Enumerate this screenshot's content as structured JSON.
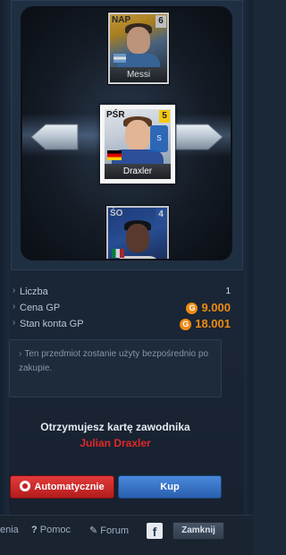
{
  "carousel": {
    "cards": [
      {
        "position": "NAP",
        "number": "6",
        "name": "Messi"
      },
      {
        "position": "PŚR",
        "number": "5",
        "name": "Draxler"
      },
      {
        "position": "ŚO",
        "number": "4",
        "name": ""
      }
    ]
  },
  "info": {
    "count_label": "Liczba",
    "count_value": "1",
    "price_label": "Cena GP",
    "price_value": "9.000",
    "balance_label": "Stan konta GP",
    "balance_value": "18.001",
    "currency_icon_glyph": "G"
  },
  "note": {
    "text": "Ten przedmiot zostanie użyty bezpośrednio po zakupie."
  },
  "reward": {
    "title": "Otrzymujesz kartę zawodnika",
    "player": "Julian Draxler"
  },
  "buttons": {
    "auto_label": "Automatycznie",
    "buy_label": "Kup"
  },
  "footer": {
    "settings_label": "enia",
    "help_label": "Pomoc",
    "forum_label": "Forum",
    "facebook_glyph": "f",
    "close_label": "Zamknij"
  },
  "colors": {
    "gp_orange": "#f08a12",
    "player_red": "#e02828",
    "buy_blue": "#2a5fae",
    "auto_red": "#c62020"
  }
}
